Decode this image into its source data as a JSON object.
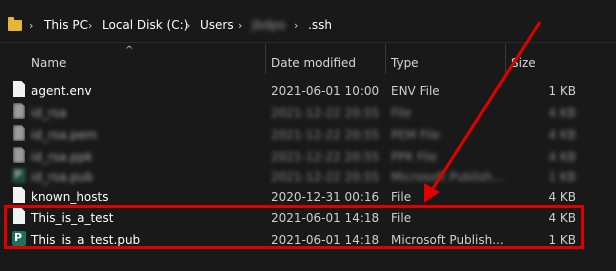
{
  "address_bar": {
    "crumbs": [
      "This PC",
      "Local Disk (C:)",
      "Users",
      "jbdpo",
      ".ssh"
    ]
  },
  "columns": {
    "name": "Name",
    "date": "Date modified",
    "type": "Type",
    "size": "Size"
  },
  "files": [
    {
      "name": "agent.env",
      "date": "2021-06-01 10:00",
      "type": "ENV File",
      "size": "1 KB",
      "icon": "file-icon"
    },
    {
      "name": "id_rsa",
      "date": "2021-12-22 20:55",
      "type": "File",
      "size": "4 KB",
      "icon": "file-icon"
    },
    {
      "name": "id_rsa.pem",
      "date": "2021-12-22 20:55",
      "type": "PEM File",
      "size": "4 KB",
      "icon": "file-icon"
    },
    {
      "name": "id_rsa.ppk",
      "date": "2021-12-22 20:55",
      "type": "PPK File",
      "size": "4 KB",
      "icon": "file-icon"
    },
    {
      "name": "id_rsa.pub",
      "date": "2021-12-22 20:55",
      "type": "Microsoft Publish...",
      "size": "1 KB",
      "icon": "publisher-icon"
    },
    {
      "name": "known_hosts",
      "date": "2020-12-31 00:16",
      "type": "File",
      "size": "4 KB",
      "icon": "file-icon"
    },
    {
      "name": "This_is_a_test",
      "date": "2021-06-01 14:18",
      "type": "File",
      "size": "4 KB",
      "icon": "file-icon"
    },
    {
      "name": "This_is_a_test.pub",
      "date": "2021-06-01 14:18",
      "type": "Microsoft Publish...",
      "size": "1 KB",
      "icon": "publisher-icon"
    }
  ],
  "colors": {
    "background": "#191919",
    "annotation": "#e00000"
  }
}
